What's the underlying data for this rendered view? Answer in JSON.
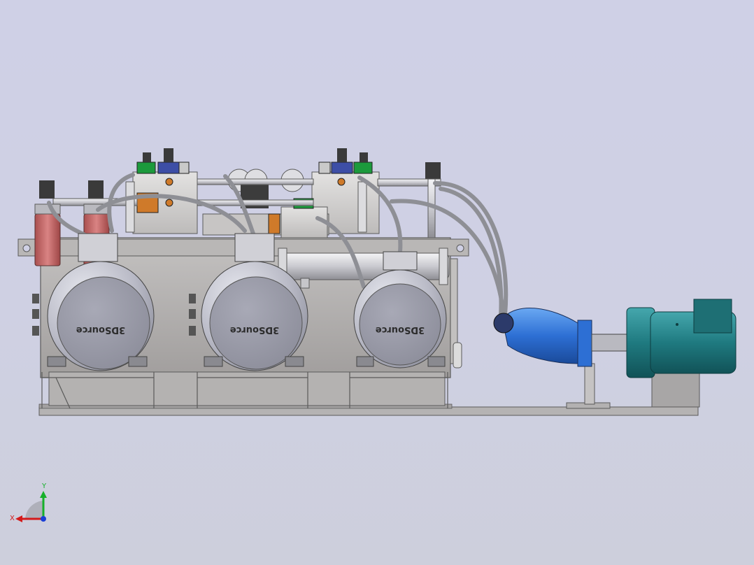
{
  "viewport": {
    "background_color": "#cfd0e4"
  },
  "model": {
    "motor_watermark": "3DSource",
    "colors": {
      "frame": "#a8a7a8",
      "tank": "#b0adac",
      "motor_body": "#c9cad3",
      "motor_face": "#9a9aa6",
      "filter": "#c86a6a",
      "hose": "#8e8f95",
      "valve_green": "#1c9a3c",
      "valve_blue": "#3d4ea6",
      "valve_orange": "#cf7a2a",
      "pump_blue": "#2d6fd4",
      "drive_motor": "#1f7a80"
    }
  },
  "triad": {
    "x_label": "X",
    "y_label": "Y",
    "x_color": "#d41a1a",
    "y_color": "#16b02a",
    "z_color": "#1a3fd6"
  }
}
